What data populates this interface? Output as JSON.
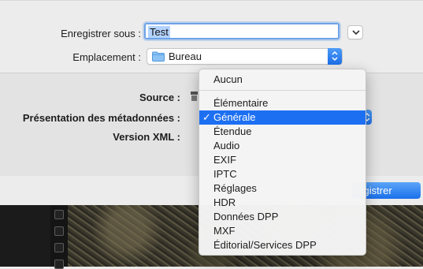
{
  "dialog": {
    "save_as_label": "Enregistrer sous :",
    "filename": "Test",
    "location_label": "Emplacement :",
    "location_value": "Bureau"
  },
  "options": {
    "source_label": "Source :",
    "metadata_label": "Présentation des métadonnées :",
    "xml_label": "Version XML :"
  },
  "buttons": {
    "save_label_partial": "registrer"
  },
  "metadata_menu": {
    "selected_value": "Générale",
    "checkmark": "✓",
    "items": [
      "Aucun",
      "Élémentaire",
      "Générale",
      "Étendue",
      "Audio",
      "EXIF",
      "IPTC",
      "Réglages",
      "HDR",
      "Données DPP",
      "MXF",
      "Éditorial/Services DPP"
    ]
  },
  "colors": {
    "accent": "#1d6ff2",
    "selection": "#b3d3ff"
  }
}
